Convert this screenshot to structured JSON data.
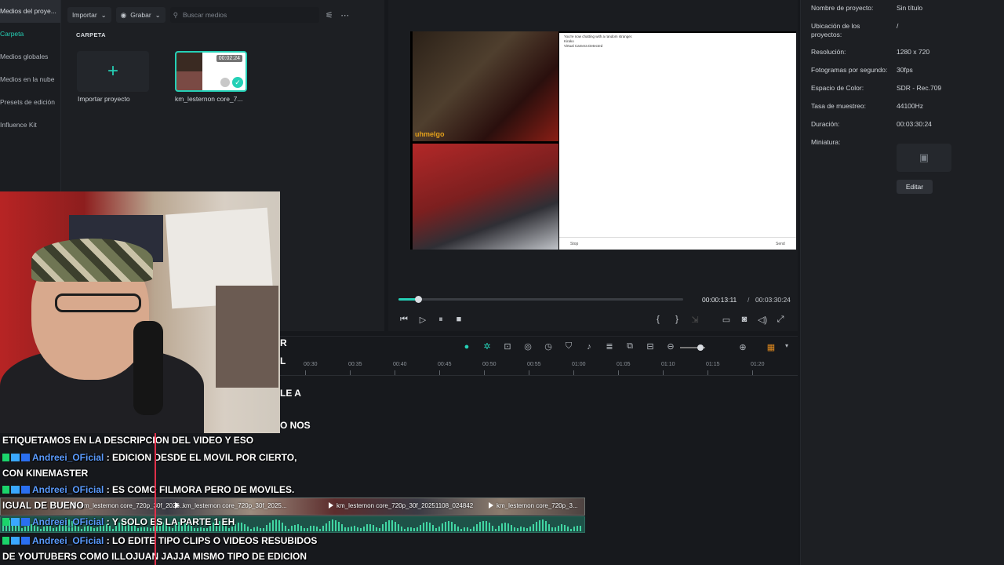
{
  "sidebar": {
    "items": [
      {
        "label": "Medios del proye..."
      },
      {
        "label": "Carpeta"
      },
      {
        "label": "Medios globales"
      },
      {
        "label": "Medios en la nube"
      },
      {
        "label": "Presets de edición"
      },
      {
        "label": "Influence Kit"
      }
    ]
  },
  "media": {
    "import_label": "Importar",
    "record_label": "Grabar",
    "search_placeholder": "Buscar medios",
    "section_title": "CARPETA",
    "import_project_label": "Importar proyecto",
    "clip_label": "km_lesternon core_7...",
    "clip_duration": "00:02:24"
  },
  "preview": {
    "cam_label": "uhmelgo",
    "chat_lines": [
      "You're now chatting with a random stranger.",
      "Kirako",
      "Virtual Camera Detected"
    ],
    "chat_stop": "Stop",
    "chat_send": "Send",
    "time_current": "00:00:13:11",
    "time_separator": "/",
    "time_total": "00:03:30:24",
    "progress": 0.07
  },
  "properties": {
    "rows": [
      {
        "label": "Nombre de proyecto:",
        "value": "Sin título"
      },
      {
        "label": "Ubicación de los proyectos:",
        "value": "/"
      },
      {
        "label": "Resolución:",
        "value": "1280 x 720"
      },
      {
        "label": "Fotogramas por segundo:",
        "value": "30fps"
      },
      {
        "label": "Espacio de Color:",
        "value": "SDR - Rec.709"
      },
      {
        "label": "Tasa de muestreo:",
        "value": "44100Hz"
      },
      {
        "label": "Duración:",
        "value": "00:03:30:24"
      },
      {
        "label": "Miniatura:",
        "value": ""
      }
    ],
    "edit_label": "Editar"
  },
  "timeline": {
    "ticks": [
      "00:30",
      "00:35",
      "00:40",
      "00:45",
      "00:50",
      "00:55",
      "01:00",
      "01:05",
      "01:10",
      "01:15",
      "01:20"
    ],
    "clips": [
      "km_lesternon core_720p_30f_2025...",
      "km_lesternon core_720p_30f_2025...",
      "km_lesternon core_720p_30f_20251108_024842",
      "km_lesternon core_720p_3..."
    ]
  },
  "fragments": {
    "f1": "R",
    "f2": "L",
    "f3": "LE A",
    "f4": "O NOS"
  },
  "chat": {
    "lines": [
      {
        "user": "",
        "text": "ETIQUETAMOS EN LA DESCRIPCION DEL VIDEO Y ESO"
      },
      {
        "user": "Andreei_OFicial",
        "text": ": EDICION DESDE EL MOVIL POR CIERTO,"
      },
      {
        "user": "",
        "text": "CON KINEMASTER"
      },
      {
        "user": "Andreei_OFicial",
        "text": ": ES COMO FILMORA PERO DE MOVILES."
      },
      {
        "user": "",
        "text": "IGUAL DE BUENO"
      },
      {
        "user": "Andreei_OFicial",
        "text": ": Y SOLO ES LA PARTE 1 EH"
      },
      {
        "user": "Andreei_OFicial",
        "text": ": LO EDITE TIPO CLIPS O VIDEOS RESUBIDOS"
      },
      {
        "user": "",
        "text": "DE YOUTUBERS COMO ILLOJUAN JAJJA MISMO TIPO DE EDICION"
      }
    ]
  },
  "colors": {
    "accent": "#25d0b6",
    "username": "#5b9cff",
    "playhead": "#e0304a"
  }
}
